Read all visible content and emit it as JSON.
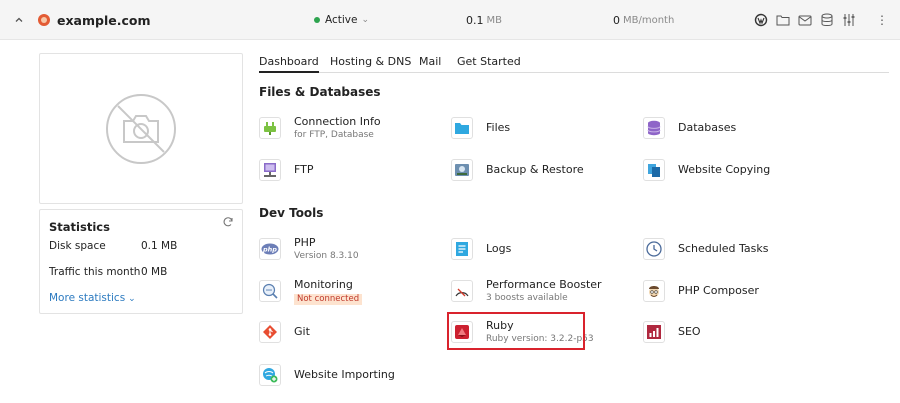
{
  "header": {
    "domain": "example.com",
    "status": "Active",
    "disk_value": "0.1",
    "disk_unit": "MB",
    "traffic_value": "0",
    "traffic_unit": "MB/month"
  },
  "statistics": {
    "title": "Statistics",
    "disk_label": "Disk space",
    "disk_value": "0.1 MB",
    "traffic_label": "Traffic this month",
    "traffic_value": "0 MB",
    "more_label": "More statistics"
  },
  "tabs": [
    {
      "label": "Dashboard",
      "active": true
    },
    {
      "label": "Hosting & DNS",
      "active": false
    },
    {
      "label": "Mail",
      "active": false
    },
    {
      "label": "Get Started",
      "active": false
    }
  ],
  "sections": {
    "files": {
      "title": "Files & Databases",
      "tools": {
        "connection": {
          "label": "Connection Info",
          "sub": "for FTP, Database",
          "icon": "plug-icon"
        },
        "files": {
          "label": "Files",
          "icon": "folder-icon"
        },
        "databases": {
          "label": "Databases",
          "icon": "database-icon"
        },
        "ftp": {
          "label": "FTP",
          "icon": "ftp-icon"
        },
        "backup": {
          "label": "Backup & Restore",
          "icon": "backup-icon"
        },
        "copying": {
          "label": "Website Copying",
          "icon": "copy-icon"
        }
      }
    },
    "dev": {
      "title": "Dev Tools",
      "tools": {
        "php": {
          "label": "PHP",
          "sub": "Version 8.3.10",
          "icon": "php-icon"
        },
        "logs": {
          "label": "Logs",
          "icon": "logs-icon"
        },
        "tasks": {
          "label": "Scheduled Tasks",
          "icon": "clock-icon"
        },
        "monitoring": {
          "label": "Monitoring",
          "badge": "Not connected",
          "icon": "monitoring-icon"
        },
        "booster": {
          "label": "Performance Booster",
          "sub": "3 boosts available",
          "icon": "gauge-icon"
        },
        "composer": {
          "label": "PHP Composer",
          "icon": "composer-icon"
        },
        "git": {
          "label": "Git",
          "icon": "git-icon"
        },
        "ruby": {
          "label": "Ruby",
          "sub": "Ruby version: 3.2.2-p53",
          "icon": "ruby-icon"
        },
        "seo": {
          "label": "SEO",
          "icon": "seo-icon"
        },
        "importing": {
          "label": "Website Importing",
          "icon": "import-icon"
        }
      }
    }
  },
  "colors": {
    "accent": "#2d7bc0",
    "active": "#2ea44f",
    "highlight": "#d9232d"
  }
}
